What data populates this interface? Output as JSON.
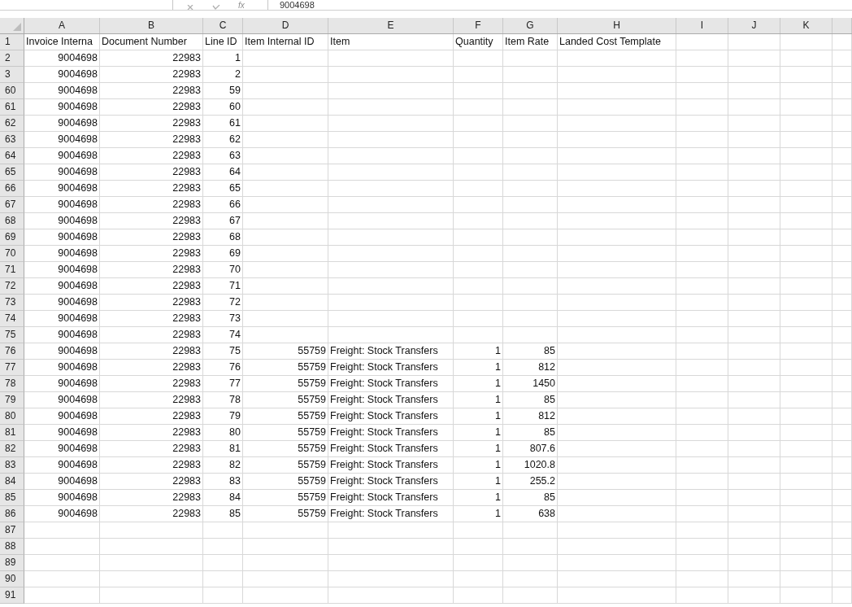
{
  "formula_bar": {
    "function_label": "fx",
    "value": "9004698"
  },
  "columns": [
    {
      "letter": "A",
      "kind": "number"
    },
    {
      "letter": "B",
      "kind": "number"
    },
    {
      "letter": "C",
      "kind": "number"
    },
    {
      "letter": "D",
      "kind": "number"
    },
    {
      "letter": "E",
      "kind": "text"
    },
    {
      "letter": "F",
      "kind": "number"
    },
    {
      "letter": "G",
      "kind": "number"
    },
    {
      "letter": "H",
      "kind": "text"
    },
    {
      "letter": "I",
      "kind": "text"
    },
    {
      "letter": "J",
      "kind": "text"
    },
    {
      "letter": "K",
      "kind": "text"
    }
  ],
  "header_row": {
    "row": "1",
    "cells": [
      "Invoice Interna",
      "Document Number",
      "Line ID",
      "Item Internal ID",
      "Item",
      "Quantity",
      "Item Rate",
      "Landed Cost Template"
    ]
  },
  "rows": [
    {
      "row": "2",
      "cells": [
        "9004698",
        "22983",
        "1"
      ]
    },
    {
      "row": "3",
      "cells": [
        "9004698",
        "22983",
        "2"
      ]
    },
    {
      "row": "60",
      "cells": [
        "9004698",
        "22983",
        "59"
      ]
    },
    {
      "row": "61",
      "cells": [
        "9004698",
        "22983",
        "60"
      ]
    },
    {
      "row": "62",
      "cells": [
        "9004698",
        "22983",
        "61"
      ]
    },
    {
      "row": "63",
      "cells": [
        "9004698",
        "22983",
        "62"
      ]
    },
    {
      "row": "64",
      "cells": [
        "9004698",
        "22983",
        "63"
      ]
    },
    {
      "row": "65",
      "cells": [
        "9004698",
        "22983",
        "64"
      ]
    },
    {
      "row": "66",
      "cells": [
        "9004698",
        "22983",
        "65"
      ]
    },
    {
      "row": "67",
      "cells": [
        "9004698",
        "22983",
        "66"
      ]
    },
    {
      "row": "68",
      "cells": [
        "9004698",
        "22983",
        "67"
      ]
    },
    {
      "row": "69",
      "cells": [
        "9004698",
        "22983",
        "68"
      ]
    },
    {
      "row": "70",
      "cells": [
        "9004698",
        "22983",
        "69"
      ]
    },
    {
      "row": "71",
      "cells": [
        "9004698",
        "22983",
        "70"
      ]
    },
    {
      "row": "72",
      "cells": [
        "9004698",
        "22983",
        "71"
      ]
    },
    {
      "row": "73",
      "cells": [
        "9004698",
        "22983",
        "72"
      ]
    },
    {
      "row": "74",
      "cells": [
        "9004698",
        "22983",
        "73"
      ]
    },
    {
      "row": "75",
      "cells": [
        "9004698",
        "22983",
        "74"
      ]
    },
    {
      "row": "76",
      "cells": [
        "9004698",
        "22983",
        "75",
        "55759",
        "Freight: Stock Transfers",
        "1",
        "85"
      ]
    },
    {
      "row": "77",
      "cells": [
        "9004698",
        "22983",
        "76",
        "55759",
        "Freight: Stock Transfers",
        "1",
        "812"
      ]
    },
    {
      "row": "78",
      "cells": [
        "9004698",
        "22983",
        "77",
        "55759",
        "Freight: Stock Transfers",
        "1",
        "1450"
      ]
    },
    {
      "row": "79",
      "cells": [
        "9004698",
        "22983",
        "78",
        "55759",
        "Freight: Stock Transfers",
        "1",
        "85"
      ]
    },
    {
      "row": "80",
      "cells": [
        "9004698",
        "22983",
        "79",
        "55759",
        "Freight: Stock Transfers",
        "1",
        "812"
      ]
    },
    {
      "row": "81",
      "cells": [
        "9004698",
        "22983",
        "80",
        "55759",
        "Freight: Stock Transfers",
        "1",
        "85"
      ]
    },
    {
      "row": "82",
      "cells": [
        "9004698",
        "22983",
        "81",
        "55759",
        "Freight: Stock Transfers",
        "1",
        "807.6"
      ]
    },
    {
      "row": "83",
      "cells": [
        "9004698",
        "22983",
        "82",
        "55759",
        "Freight: Stock Transfers",
        "1",
        "1020.8"
      ]
    },
    {
      "row": "84",
      "cells": [
        "9004698",
        "22983",
        "83",
        "55759",
        "Freight: Stock Transfers",
        "1",
        "255.2"
      ]
    },
    {
      "row": "85",
      "cells": [
        "9004698",
        "22983",
        "84",
        "55759",
        "Freight: Stock Transfers",
        "1",
        "85"
      ]
    },
    {
      "row": "86",
      "cells": [
        "9004698",
        "22983",
        "85",
        "55759",
        "Freight: Stock Transfers",
        "1",
        "638"
      ]
    },
    {
      "row": "87"
    },
    {
      "row": "88"
    },
    {
      "row": "89"
    },
    {
      "row": "90"
    },
    {
      "row": "91"
    }
  ]
}
